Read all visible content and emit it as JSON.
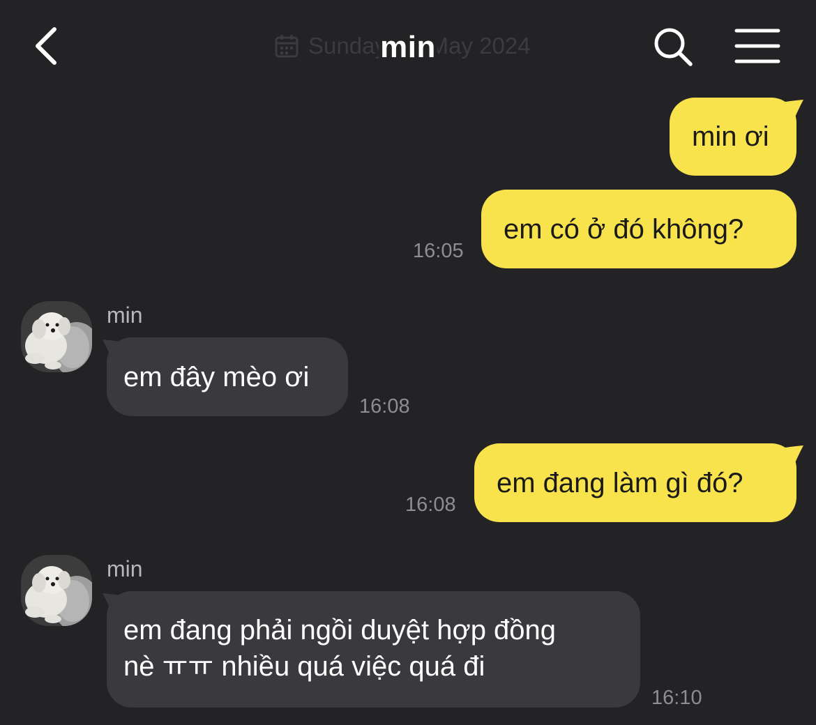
{
  "header": {
    "title": "min",
    "date_overlay": "Sunday, 12 May 2024"
  },
  "messages": [
    {
      "direction": "out",
      "text": "min ơi"
    },
    {
      "direction": "out",
      "text": "em có ở đó không?",
      "time": "16:05"
    },
    {
      "direction": "in",
      "sender": "min",
      "text": "em đây mèo ơi",
      "time": "16:08"
    },
    {
      "direction": "out",
      "text": "em đang làm gì đó?",
      "time": "16:08"
    },
    {
      "direction": "in",
      "sender": "min",
      "lines": [
        "em đang phải ngồi duyệt hợp đồng",
        "nè ㅠㅠ nhiều quá việc quá đi"
      ],
      "time": "16:10"
    }
  ],
  "colors": {
    "background": "#232326",
    "outgoing_bubble": "#f8e34d",
    "incoming_bubble": "#3a3a3e",
    "timestamp": "#8d8d92"
  },
  "icons": {
    "back": "chevron-left-icon",
    "calendar": "calendar-icon",
    "search": "search-icon",
    "menu": "menu-icon",
    "avatar": "dog-avatar"
  }
}
